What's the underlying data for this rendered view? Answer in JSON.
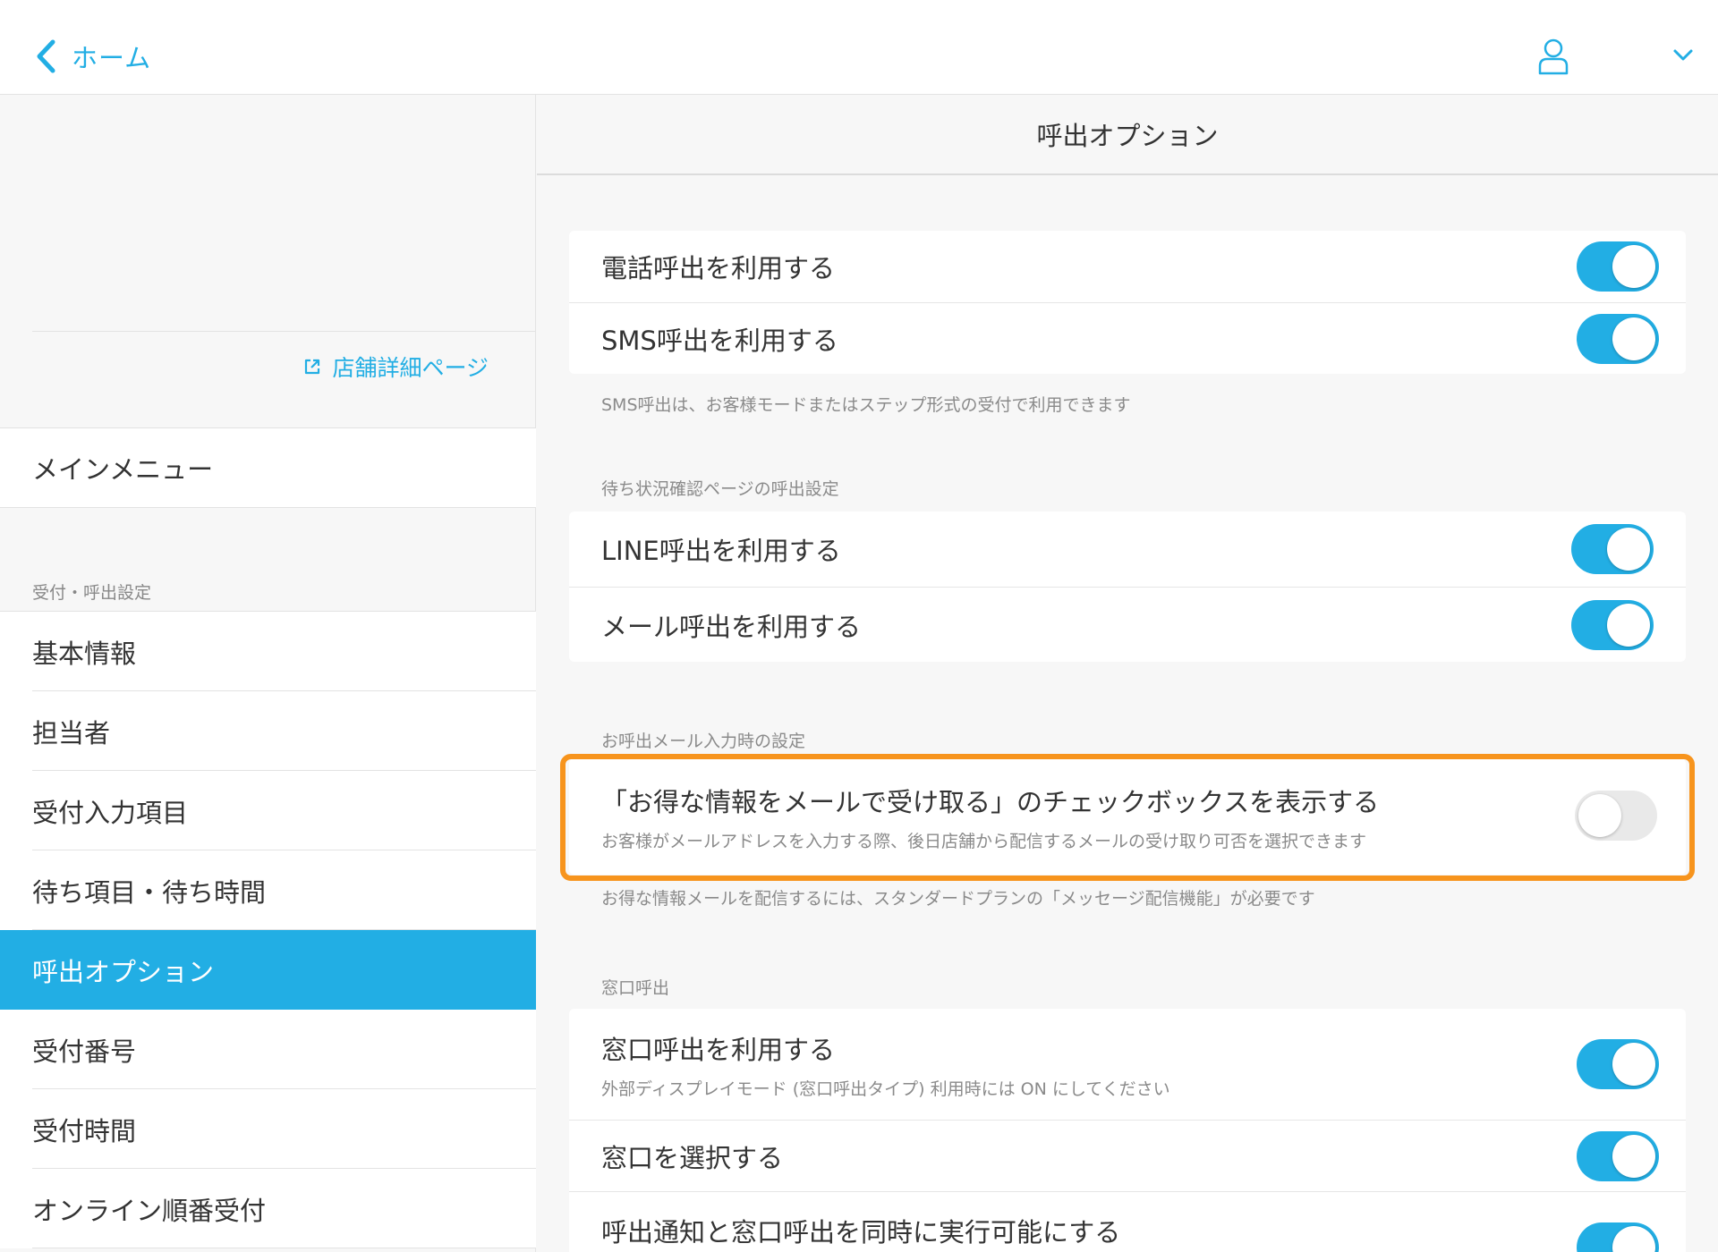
{
  "header": {
    "back_label": "ホーム"
  },
  "sidebar": {
    "shop_link": "店舗詳細ページ",
    "main_menu": "メインメニュー",
    "section_label": "受付・呼出設定",
    "items": [
      {
        "label": "基本情報"
      },
      {
        "label": "担当者"
      },
      {
        "label": "受付入力項目"
      },
      {
        "label": "待ち項目・待ち時間"
      },
      {
        "label": "呼出オプション"
      },
      {
        "label": "受付番号"
      },
      {
        "label": "受付時間"
      },
      {
        "label": "オンライン順番受付"
      }
    ],
    "active_index": 4
  },
  "main": {
    "title": "呼出オプション",
    "call_options": {
      "phone_label": "電話呼出を利用する",
      "phone_on": true,
      "sms_label": "SMS呼出を利用する",
      "sms_on": true,
      "note": "SMS呼出は、お客様モードまたはステップ形式の受付で利用できます"
    },
    "status_page": {
      "section": "待ち状況確認ページの呼出設定",
      "line_label": "LINE呼出を利用する",
      "line_on": true,
      "mail_label": "メール呼出を利用する",
      "mail_on": true
    },
    "mail_input": {
      "section": "お呼出メール入力時の設定",
      "checkbox_label": "「お得な情報をメールで受け取る」のチェックボックスを表示する",
      "checkbox_sub": "お客様がメールアドレスを入力する際、後日店舗から配信するメールの受け取り可否を選択できます",
      "checkbox_on": false,
      "note": "お得な情報メールを配信するには、スタンダードプランの「メッセージ配信機能」が必要です"
    },
    "window_call": {
      "section": "窓口呼出",
      "use_label": "窓口呼出を利用する",
      "use_sub": "外部ディスプレイモード (窓口呼出タイプ) 利用時には ON にしてください",
      "use_on": true,
      "select_label": "窓口を選択する",
      "select_on": true,
      "simul_label": "呼出通知と窓口呼出を同時に実行可能にする",
      "simul_on": true
    }
  },
  "colors": {
    "accent": "#22aee4",
    "highlight": "#f7941d",
    "toggle_off": "#e9e9e9"
  }
}
